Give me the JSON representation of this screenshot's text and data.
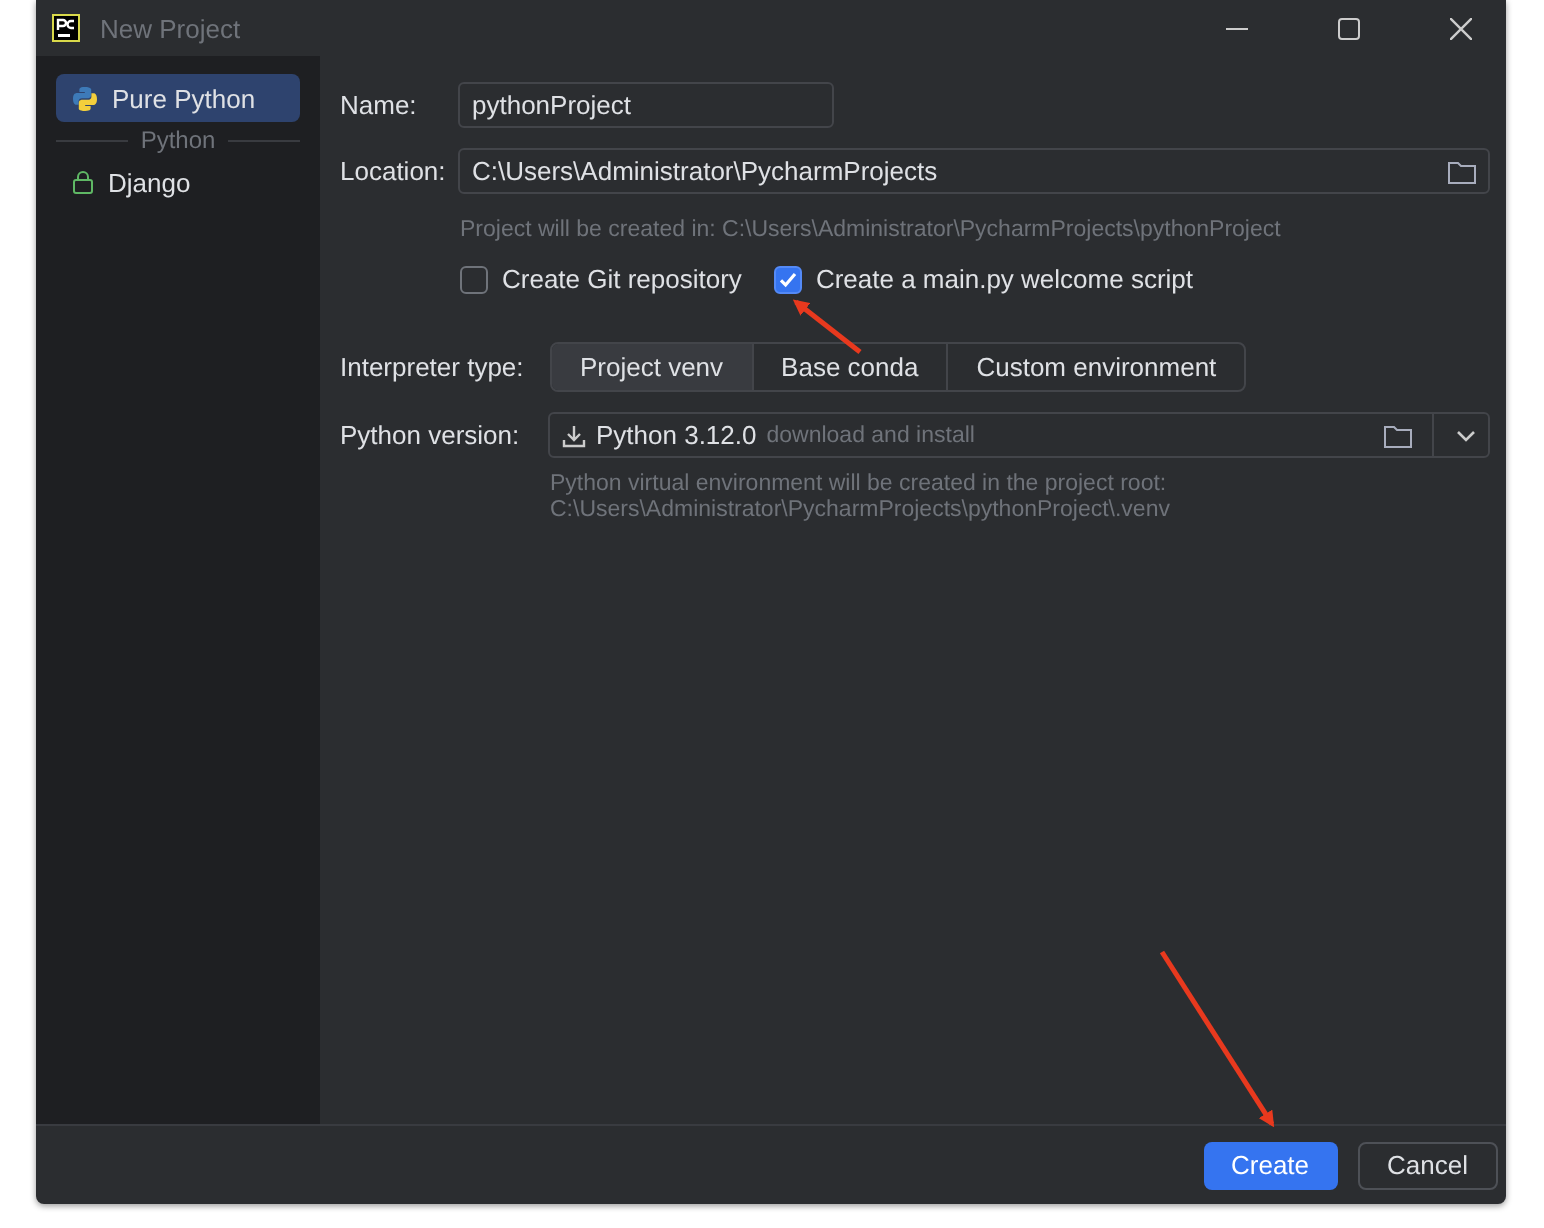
{
  "window": {
    "title": "New Project"
  },
  "sidebar": {
    "items": [
      {
        "kind": "item",
        "label": "Pure Python",
        "selected": true,
        "locked": false
      },
      {
        "kind": "heading",
        "label": "Python"
      },
      {
        "kind": "item",
        "label": "Django",
        "selected": false,
        "locked": true
      }
    ]
  },
  "form": {
    "name": {
      "label": "Name:",
      "value": "pythonProject"
    },
    "location": {
      "label": "Location:",
      "value": "C:\\Users\\Administrator\\PycharmProjects"
    },
    "location_hint": "Project will be created in: C:\\Users\\Administrator\\PycharmProjects\\pythonProject",
    "checkboxes": [
      {
        "label": "Create Git repository",
        "checked": false
      },
      {
        "label": "Create a main.py welcome script",
        "checked": true
      }
    ],
    "interpreter_type": {
      "label": "Interpreter type:",
      "options": [
        {
          "label": "Project venv",
          "selected": true
        },
        {
          "label": "Base conda",
          "selected": false
        },
        {
          "label": "Custom environment",
          "selected": false
        }
      ]
    },
    "python_version": {
      "label": "Python version:",
      "value": "Python 3.12.0",
      "note": "download and install"
    },
    "venv_hint": [
      "Python virtual environment will be created in the project root:",
      "C:\\Users\\Administrator\\PycharmProjects\\pythonProject\\.venv"
    ]
  },
  "buttons": [
    {
      "label": "Create",
      "kind": "primary"
    },
    {
      "label": "Cancel",
      "kind": "secondary"
    }
  ]
}
